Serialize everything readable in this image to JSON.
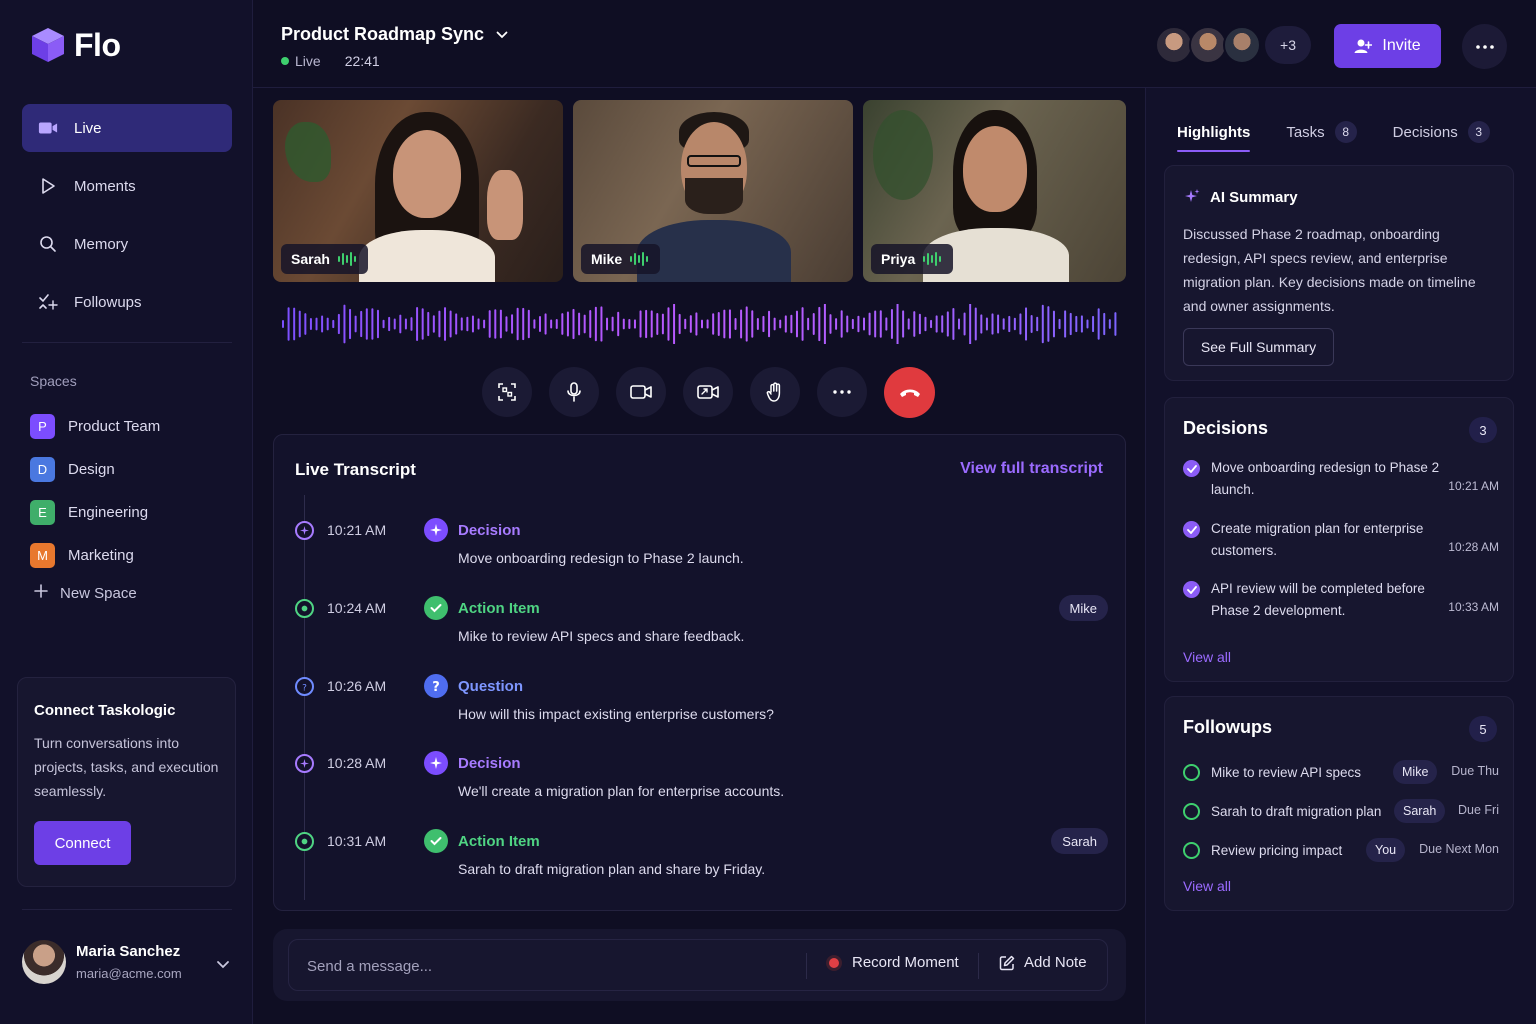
{
  "brand": {
    "name": "Flo"
  },
  "nav": [
    {
      "label": "Live",
      "icon": "camera-icon",
      "active": true
    },
    {
      "label": "Moments",
      "icon": "play-icon",
      "active": false
    },
    {
      "label": "Memory",
      "icon": "search-icon",
      "active": false
    },
    {
      "label": "Followups",
      "icon": "sparkle-check-icon",
      "active": false
    }
  ],
  "spaces": {
    "title": "Spaces",
    "items": [
      {
        "initial": "P",
        "label": "Product Team",
        "color": "#7c4dff"
      },
      {
        "initial": "D",
        "label": "Design",
        "color": "#4a78e0"
      },
      {
        "initial": "E",
        "label": "Engineering",
        "color": "#3fae6a"
      },
      {
        "initial": "M",
        "label": "Marketing",
        "color": "#e8782e"
      }
    ],
    "new_label": "New Space"
  },
  "connect_card": {
    "title": "Connect Taskologic",
    "description": "Turn conversations into projects, tasks, and execution seamlessly.",
    "button": "Connect"
  },
  "user": {
    "name": "Maria Sanchez",
    "email": "maria@acme.com"
  },
  "meeting": {
    "title": "Product Roadmap Sync",
    "status": "Live",
    "elapsed": "22:41"
  },
  "participants": {
    "extra_count": "+3"
  },
  "header": {
    "invite_label": "Invite"
  },
  "tiles": [
    {
      "name": "Sarah"
    },
    {
      "name": "Mike"
    },
    {
      "name": "Priya"
    }
  ],
  "controls": [
    "layout-icon",
    "microphone-icon",
    "video-camera-icon",
    "share-screen-icon",
    "raise-hand-icon",
    "more-icon",
    "end-call-icon"
  ],
  "transcript": {
    "title": "Live Transcript",
    "link": "View full transcript",
    "entries": [
      {
        "time": "10:21 AM",
        "type": "Decision",
        "text": "Move onboarding redesign to Phase 2 launch.",
        "tag": ""
      },
      {
        "time": "10:24 AM",
        "type": "Action Item",
        "text": "Mike to review API specs and share feedback.",
        "tag": "Mike"
      },
      {
        "time": "10:26 AM",
        "type": "Question",
        "text": "How will this impact existing enterprise customers?",
        "tag": ""
      },
      {
        "time": "10:28 AM",
        "type": "Decision",
        "text": "We'll create a migration plan for enterprise accounts.",
        "tag": ""
      },
      {
        "time": "10:31 AM",
        "type": "Action Item",
        "text": "Sarah to draft migration plan and share by Friday.",
        "tag": "Sarah"
      }
    ]
  },
  "composer": {
    "placeholder": "Send a message...",
    "record_label": "Record Moment",
    "note_label": "Add Note"
  },
  "right_panel": {
    "tabs": [
      {
        "label": "Highlights",
        "count": ""
      },
      {
        "label": "Tasks",
        "count": "8"
      },
      {
        "label": "Decisions",
        "count": "3"
      }
    ],
    "ai_summary": {
      "title": "AI Summary",
      "text": "Discussed Phase 2 roadmap, onboarding redesign, API specs review, and enterprise migration plan. Key decisions made on timeline and owner assignments.",
      "button": "See Full Summary"
    },
    "decisions": {
      "title": "Decisions",
      "count": "3",
      "items": [
        {
          "text": "Move onboarding redesign to Phase 2 launch.",
          "time": "10:21 AM"
        },
        {
          "text": "Create migration plan for enterprise customers.",
          "time": "10:28 AM"
        },
        {
          "text": "API review will be completed before Phase 2 development.",
          "time": "10:33 AM"
        }
      ],
      "view_all": "View all"
    },
    "followups": {
      "title": "Followups",
      "count": "5",
      "items": [
        {
          "text": "Mike to review API specs",
          "owner": "Mike",
          "due": "Due Thu"
        },
        {
          "text": "Sarah to draft migration plan",
          "owner": "Sarah",
          "due": "Due Fri"
        },
        {
          "text": "Review pricing impact",
          "owner": "You",
          "due": "Due Next Mon"
        }
      ],
      "view_all": "View all"
    }
  },
  "colors": {
    "accent": "#6d3fe6",
    "decision": "#a77bff",
    "action": "#4fd483",
    "question": "#6f8bff",
    "end_call": "#e03a3e"
  }
}
